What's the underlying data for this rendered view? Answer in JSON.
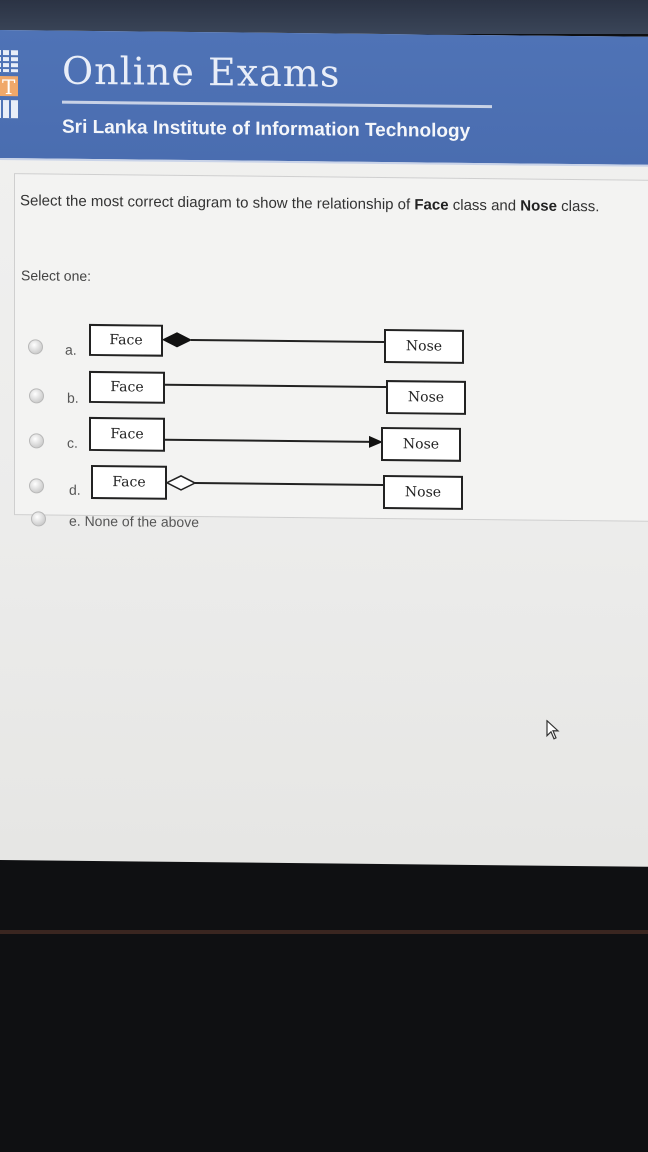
{
  "header": {
    "site_title": "Online Exams",
    "institute": "Sri Lanka Institute of Information Technology",
    "colors": {
      "bar": "#4f73b6",
      "text": "#e9eef8"
    }
  },
  "question": {
    "prefix": "Select the most correct diagram to show the relationship of ",
    "class_a": "Face",
    "middle": " class and ",
    "class_b": "Nose",
    "suffix": " class.",
    "prompt": "Select one:"
  },
  "options": [
    {
      "letter": "a.",
      "left_box": "Face",
      "right_box": "Nose",
      "connector": "filled-diamond"
    },
    {
      "letter": "b.",
      "left_box": "Face",
      "right_box": "Nose",
      "connector": "plain-line"
    },
    {
      "letter": "c.",
      "left_box": "Face",
      "right_box": "Nose",
      "connector": "filled-arrow"
    },
    {
      "letter": "d.",
      "left_box": "Face",
      "right_box": "Nose",
      "connector": "hollow-diamond"
    },
    {
      "letter": "e. None of the above"
    }
  ]
}
